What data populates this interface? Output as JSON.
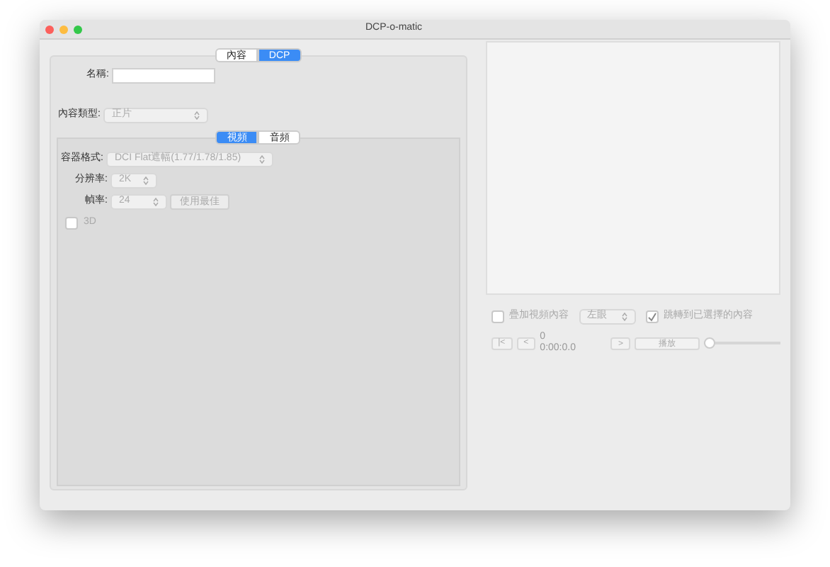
{
  "window": {
    "title": "DCP-o-matic"
  },
  "top_tabs": [
    {
      "label": "內容",
      "selected": false
    },
    {
      "label": "DCP",
      "selected": true
    }
  ],
  "name_field": {
    "label": "名稱:"
  },
  "content_type": {
    "label": "內容類型:",
    "value": "正片"
  },
  "sub_tabs": [
    {
      "label": "視頻",
      "selected": true
    },
    {
      "label": "音頻",
      "selected": false
    }
  ],
  "container": {
    "label": "容器格式:",
    "value": "DCI Flat遮幅(1.77/1.78/1.85)"
  },
  "resolution": {
    "label": "分辨率:",
    "value": "2K"
  },
  "frame_rate": {
    "label": "幀率:",
    "value": "24",
    "button": "使用最佳"
  },
  "three_d": {
    "label": "3D",
    "checked": false
  },
  "viewer": {
    "overlay": {
      "label": "疊加視頻內容",
      "checked": false
    },
    "eye": "左眼",
    "jump": {
      "label": "跳轉到已選擇的內容",
      "checked": true
    },
    "buttons": [
      "|<",
      "<"
    ],
    "frame": "0",
    "timecode": "0:00:0.0",
    "next": ">",
    "play": "播放",
    "position": {
      "level": 0
    }
  }
}
